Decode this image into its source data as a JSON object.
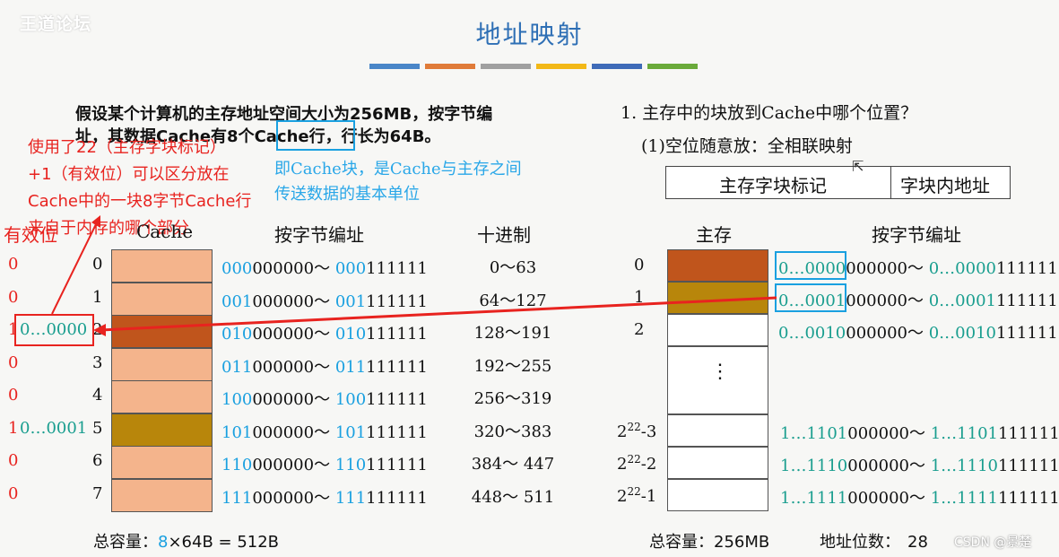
{
  "header": {
    "watermark": "王道论坛",
    "title": "地址映射",
    "bar_colors": [
      "#4a86c8",
      "#e07b39",
      "#a0a0a0",
      "#f2b817",
      "#3f6bb8",
      "#6aaa3a"
    ]
  },
  "problem": {
    "line1": "假设某个计算机的主存地址空间大小为256MB，按字节编",
    "line2_a": "址，其数据Cache有8个",
    "line2_boxed": "Cache行",
    "line2_b": "，行长为64B。"
  },
  "notes": {
    "red": [
      "使用了22（主存字块标记）",
      "+1（有效位）可以区分放在",
      "Cache中的一块8字节Cache行",
      "来自于内存的哪个部分"
    ],
    "blue": [
      "即Cache块，是Cache与主存之间",
      "传送数据的基本单位"
    ]
  },
  "question": {
    "q1": "1. 主存中的块放到Cache中哪个位置？",
    "q1_sub": "(1)空位随意放：全相联映射",
    "tag_label": "主存字块标记",
    "offset_label": "字块内地址"
  },
  "cache_table": {
    "valid_header": "有效位",
    "cache_header": "Cache",
    "addr_header": "按字节编址",
    "dec_header": "十进制",
    "rows": [
      {
        "valid": "0",
        "tag": "",
        "idx": "0",
        "color": "#f4b48c",
        "bin_hi": "000",
        "bin_lo": "000000",
        "bin_hi2": "000",
        "bin_lo2": "111111",
        "dec": "0～63"
      },
      {
        "valid": "0",
        "tag": "",
        "idx": "1",
        "color": "#f4b48c",
        "bin_hi": "001",
        "bin_lo": "000000",
        "bin_hi2": "001",
        "bin_lo2": "111111",
        "dec": "64～127"
      },
      {
        "valid": "1",
        "tag": "0…0000",
        "idx": "2",
        "color": "#c0551c",
        "bin_hi": "010",
        "bin_lo": "000000",
        "bin_hi2": "010",
        "bin_lo2": "111111",
        "dec": "128～191"
      },
      {
        "valid": "0",
        "tag": "",
        "idx": "3",
        "color": "#f4b48c",
        "bin_hi": "011",
        "bin_lo": "000000",
        "bin_hi2": "011",
        "bin_lo2": "111111",
        "dec": "192～255"
      },
      {
        "valid": "0",
        "tag": "",
        "idx": "4",
        "color": "#f4b48c",
        "bin_hi": "100",
        "bin_lo": "000000",
        "bin_hi2": "100",
        "bin_lo2": "111111",
        "dec": "256～319"
      },
      {
        "valid": "1",
        "tag": "0…0001",
        "idx": "5",
        "color": "#b8860b",
        "bin_hi": "101",
        "bin_lo": "000000",
        "bin_hi2": "101",
        "bin_lo2": "111111",
        "dec": "320～383"
      },
      {
        "valid": "0",
        "tag": "",
        "idx": "6",
        "color": "#f4b48c",
        "bin_hi": "110",
        "bin_lo": "000000",
        "bin_hi2": "110",
        "bin_lo2": "111111",
        "dec": "384～ 447"
      },
      {
        "valid": "0",
        "tag": "",
        "idx": "7",
        "color": "#f4b48c",
        "bin_hi": "111",
        "bin_lo": "000000",
        "bin_hi2": "111",
        "bin_lo2": "111111",
        "dec": "448～ 511"
      }
    ],
    "capacity_label": "总容量：",
    "capacity_count": "8",
    "capacity_rest": "×64B = 512B"
  },
  "memory": {
    "mem_header": "主存",
    "addr_header": "按字节编址",
    "rows": [
      {
        "idx": "0",
        "color": "#c0551c",
        "hi": "0…0000",
        "lo": "000000",
        "hi2": "0…0000",
        "lo2": "111111"
      },
      {
        "idx": "1",
        "color": "#b8860b",
        "hi": "0…0001",
        "lo": "000000",
        "hi2": "0…0001",
        "lo2": "111111"
      },
      {
        "idx": "2",
        "color": "#ffffff",
        "hi": "0…0010",
        "lo": "000000",
        "hi2": "0…0010",
        "lo2": "111111"
      }
    ],
    "ellipsis": "⋮",
    "tail_rows": [
      {
        "idx_base": "2",
        "idx_exp": "22",
        "idx_suffix": "-3",
        "hi": "1…1101",
        "lo": "000000",
        "hi2": "1…1101",
        "lo2": "111111"
      },
      {
        "idx_base": "2",
        "idx_exp": "22",
        "idx_suffix": "-2",
        "hi": "1…1110",
        "lo": "000000",
        "hi2": "1…1110",
        "lo2": "111111"
      },
      {
        "idx_base": "2",
        "idx_exp": "22",
        "idx_suffix": "-1",
        "hi": "1…1111",
        "lo": "000000",
        "hi2": "1…1111",
        "lo2": "111111"
      }
    ],
    "tilde": "～",
    "capacity_label": "总容量：",
    "capacity_value": "256MB",
    "addr_bits_label": "地址位数：",
    "addr_bits_value": "28",
    "footer_mark": "CSDN @景楚"
  }
}
